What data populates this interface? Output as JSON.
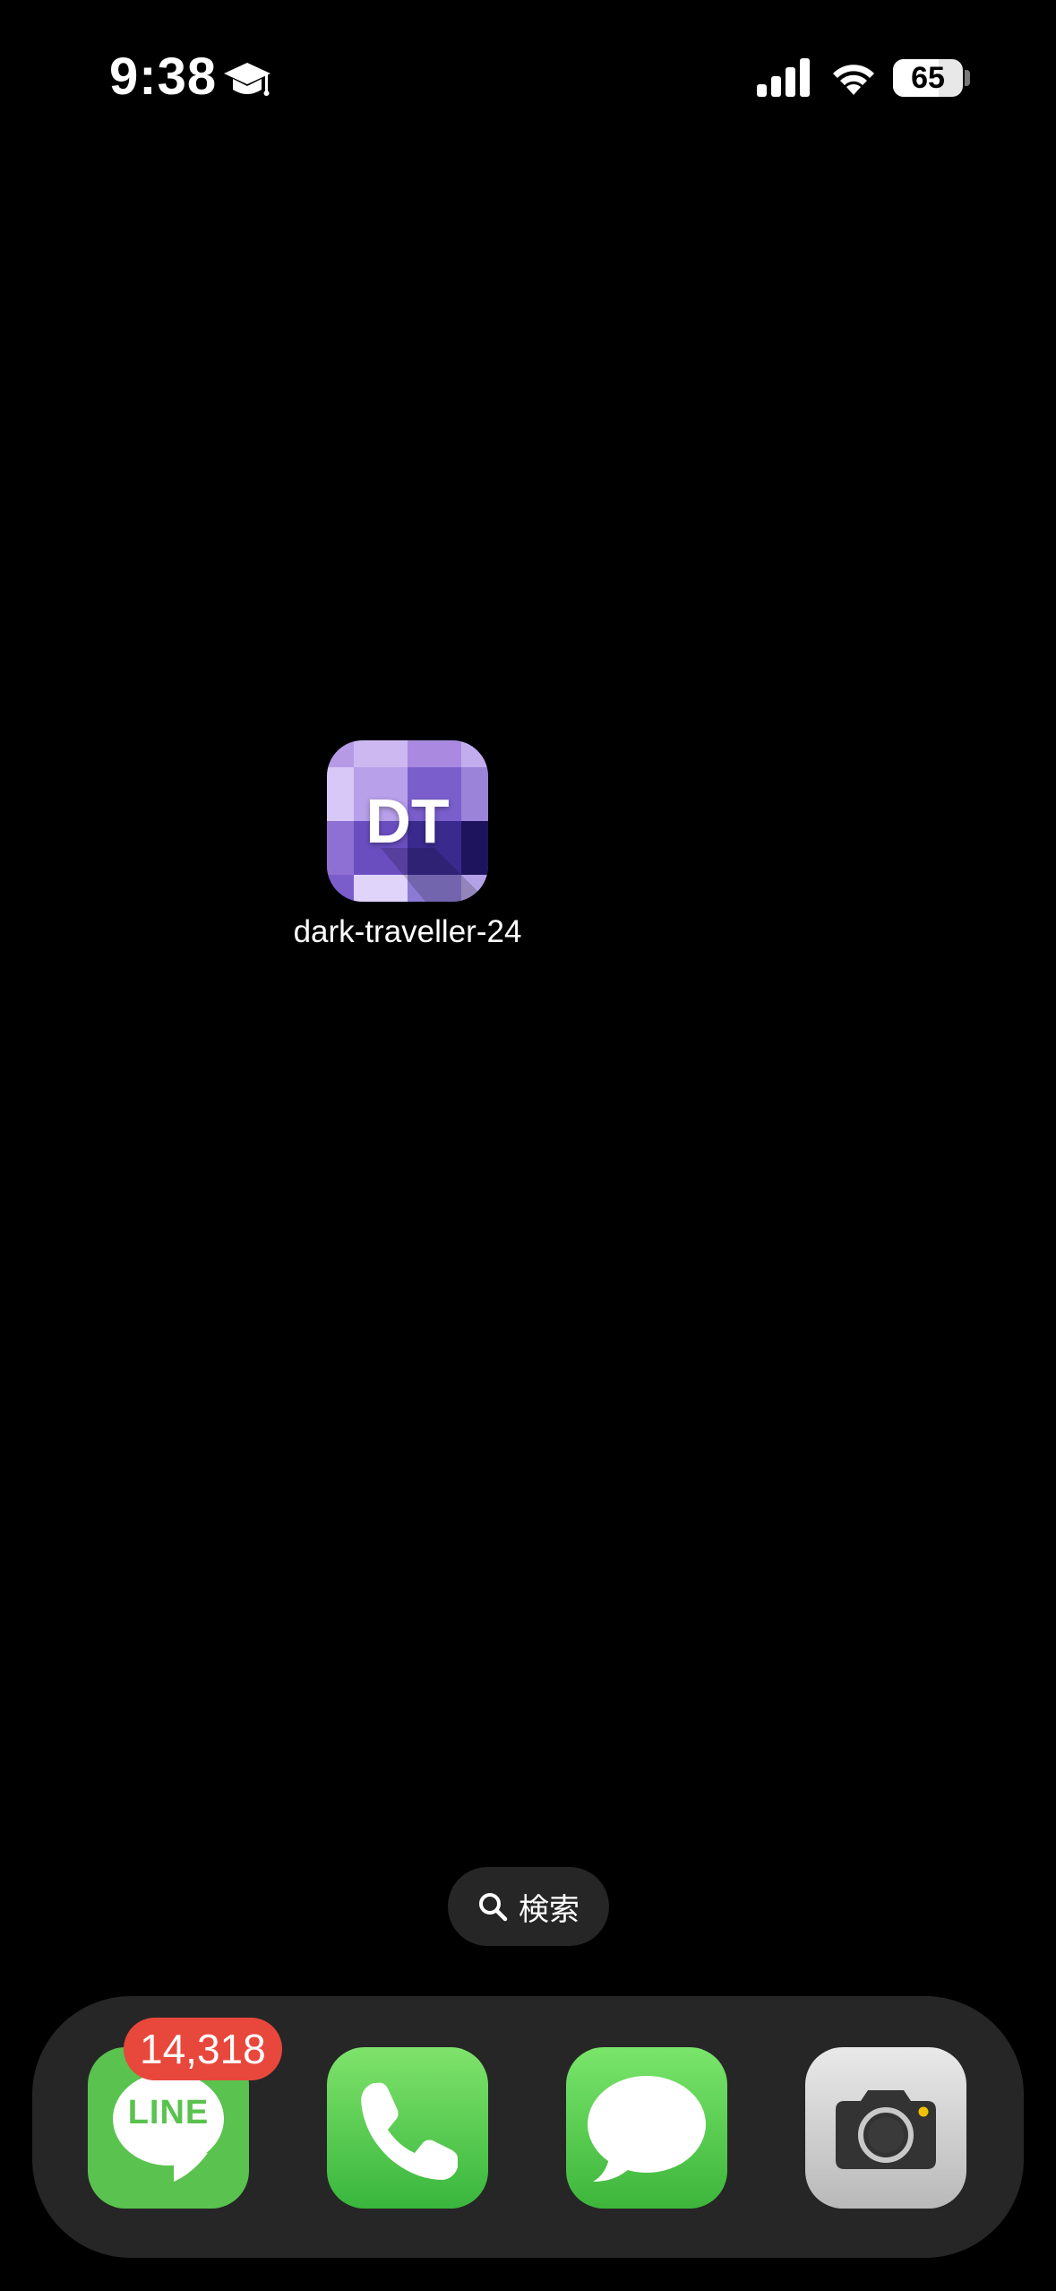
{
  "status_bar": {
    "time": "9:38",
    "battery_percent": "65",
    "battery_level": 0.65,
    "icons": [
      "graduation-cap-icon",
      "cellular-signal-icon",
      "wifi-icon",
      "battery-icon"
    ]
  },
  "home": {
    "apps": [
      {
        "name": "dark-traveller-24",
        "icon_text": "DT",
        "icon": "dark-traveller-app-icon"
      }
    ]
  },
  "search": {
    "label": "検索",
    "icon": "search-icon"
  },
  "dock": {
    "apps": [
      {
        "name": "LINE",
        "icon_text": "LINE",
        "badge": "14,318",
        "icon": "line-app-icon",
        "color": "#5ac24e"
      },
      {
        "name": "Phone",
        "icon": "phone-app-icon",
        "color": "#4cc446"
      },
      {
        "name": "Messages",
        "icon": "messages-app-icon",
        "color": "#4ac145"
      },
      {
        "name": "Camera",
        "icon": "camera-app-icon",
        "color": "#c9c9c9"
      }
    ]
  },
  "colors": {
    "background": "#000000",
    "badge": "#e8473c",
    "dock": "#262626"
  }
}
